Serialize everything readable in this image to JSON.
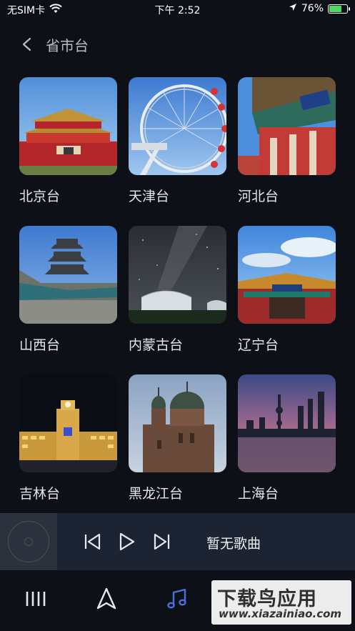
{
  "status_bar": {
    "carrier": "无SIM卡",
    "time": "下午 2:52",
    "battery_percent": "76%",
    "battery_level": 0.76
  },
  "header": {
    "title": "省市台"
  },
  "stations": [
    {
      "name": "北京台",
      "image": "tiananmen-gate"
    },
    {
      "name": "天津台",
      "image": "tianjin-eye-ferris-wheel"
    },
    {
      "name": "河北台",
      "image": "shanhaiguan-pass"
    },
    {
      "name": "山西台",
      "image": "pagoda-temple"
    },
    {
      "name": "内蒙古台",
      "image": "yurt-milky-way"
    },
    {
      "name": "辽宁台",
      "image": "shenyang-palace-gate"
    },
    {
      "name": "吉林台",
      "image": "night-station-building"
    },
    {
      "name": "黑龙江台",
      "image": "st-sophia-cathedral"
    },
    {
      "name": "上海台",
      "image": "shanghai-skyline-dusk"
    }
  ],
  "player": {
    "song_title": "暂无歌曲"
  },
  "tabs": [
    {
      "icon": "library-icon",
      "active": false
    },
    {
      "icon": "navigate-icon",
      "active": false
    },
    {
      "icon": "music-note-icon",
      "active": true
    }
  ],
  "watermark": {
    "brand": "下载鸟应用",
    "domain": "www.xiazainiao.com"
  },
  "colors": {
    "background": "#0e1017",
    "player_bar": "#1c2433",
    "active_tab": "#4a6fd8",
    "battery_fill": "#4cd964"
  }
}
